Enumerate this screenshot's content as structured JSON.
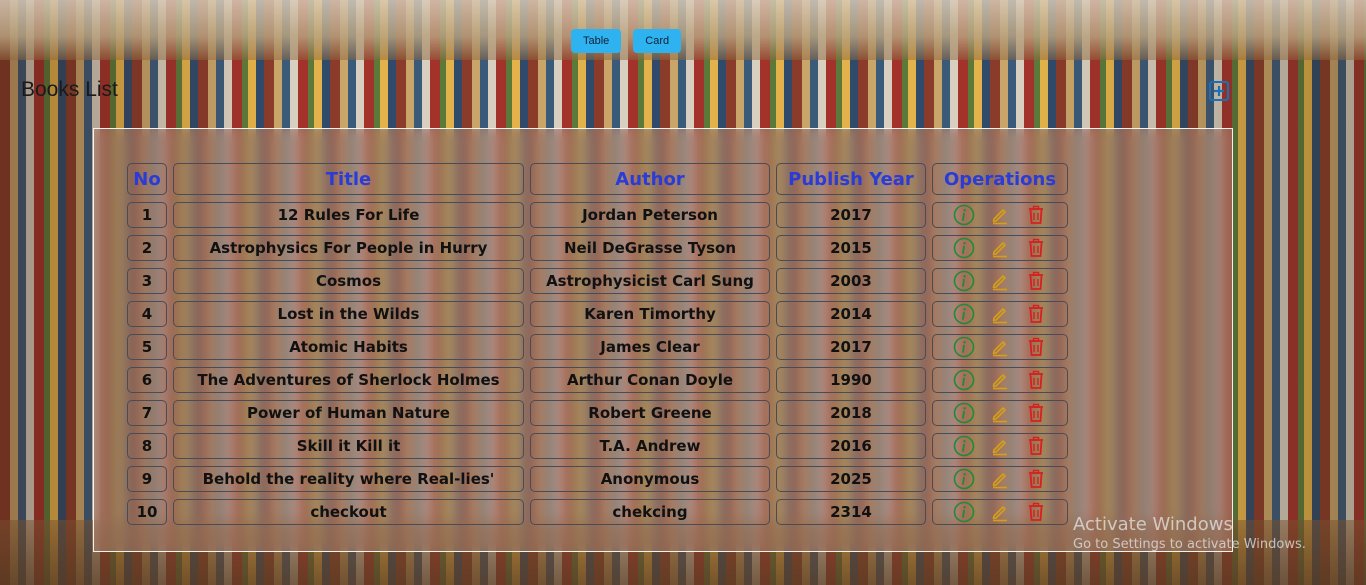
{
  "view_toggle": {
    "table_label": "Table",
    "card_label": "Card"
  },
  "page": {
    "title": "Books List"
  },
  "table": {
    "headers": [
      "No",
      "Title",
      "Author",
      "Publish Year",
      "Operations"
    ],
    "rows": [
      {
        "no": "1",
        "title": "12 Rules For Life",
        "author": "Jordan Peterson",
        "year": "2017"
      },
      {
        "no": "2",
        "title": "Astrophysics For People in Hurry",
        "author": "Neil DeGrasse Tyson",
        "year": "2015"
      },
      {
        "no": "3",
        "title": "Cosmos",
        "author": "Astrophysicist Carl Sung",
        "year": "2003"
      },
      {
        "no": "4",
        "title": "Lost in the Wilds",
        "author": "Karen Timorthy",
        "year": "2014"
      },
      {
        "no": "5",
        "title": "Atomic Habits",
        "author": "James Clear",
        "year": "2017"
      },
      {
        "no": "6",
        "title": "The Adventures of Sherlock Holmes",
        "author": "Arthur Conan Doyle",
        "year": "1990"
      },
      {
        "no": "7",
        "title": "Power of Human Nature",
        "author": "Robert Greene",
        "year": "2018"
      },
      {
        "no": "8",
        "title": "Skill it Kill it",
        "author": "T.A. Andrew",
        "year": "2016"
      },
      {
        "no": "9",
        "title": "Behold the reality where Real-lies'",
        "author": "Anonymous",
        "year": "2025"
      },
      {
        "no": "10",
        "title": "checkout",
        "author": "chekcing",
        "year": "2314"
      }
    ]
  },
  "icons": {
    "add": "plus-square-icon",
    "info": "info-circle-icon",
    "edit": "pencil-icon",
    "delete": "trash-icon"
  },
  "colors": {
    "header_text": "#2a3bd6",
    "toggle_button": "#2fb3f0",
    "info": "#1f8a3a",
    "edit": "#d4a017",
    "delete": "#d62020",
    "add": "#1b6fb8"
  },
  "watermark": {
    "title": "Activate Windows",
    "subtitle": "Go to Settings to activate Windows."
  }
}
